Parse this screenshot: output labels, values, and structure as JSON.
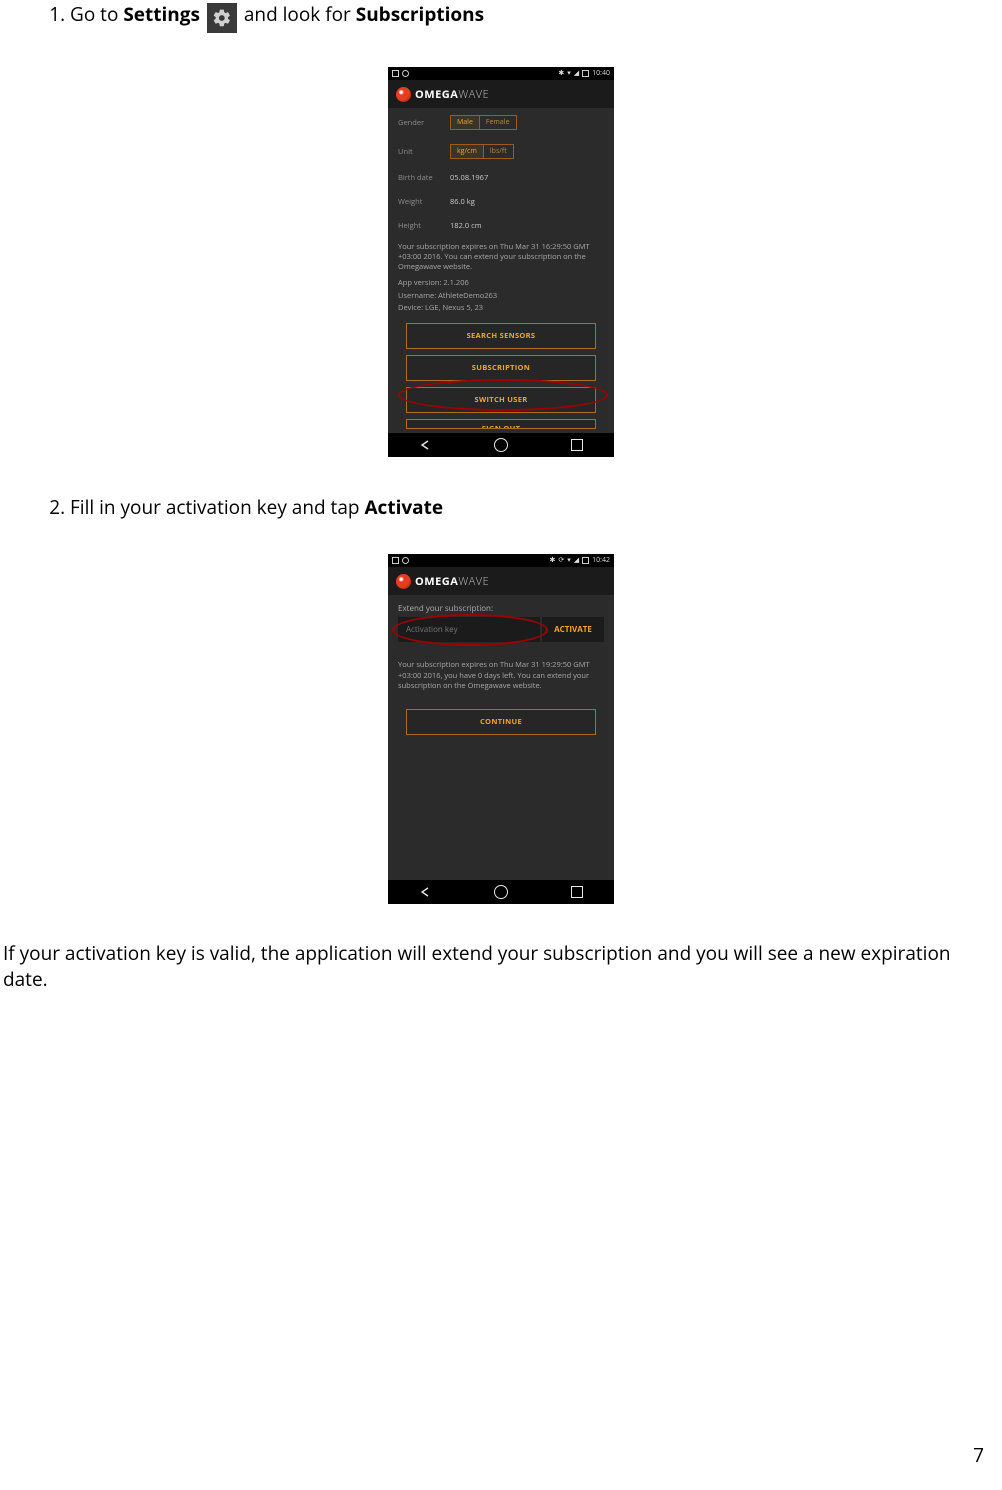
{
  "page_number": "7",
  "step1": {
    "num": "1.",
    "pre": "Go to ",
    "bold1": "Settings",
    "mid": " and look for ",
    "bold2": "Subscriptions"
  },
  "step2": {
    "num": "2.",
    "pre": "Fill in your activation key and tap ",
    "bold1": "Activate"
  },
  "closing": "If your activation key is valid, the application will extend your subscription and you will see a new expiration date.",
  "brand": {
    "part1": "OMEGA",
    "part2": "WAVE"
  },
  "shot1": {
    "time": "10:40",
    "rows": {
      "gender": {
        "label": "Gender",
        "opt1": "Male",
        "opt2": "Female"
      },
      "unit": {
        "label": "Unit",
        "opt1": "kg/cm",
        "opt2": "lbs/ft"
      },
      "birth": {
        "label": "Birth date",
        "value": "05.08.1967"
      },
      "weight": {
        "label": "Weight",
        "value": "86.0 kg"
      },
      "height": {
        "label": "Height",
        "value": "182.0 cm"
      }
    },
    "sub1": "Your subscription expires on Thu Mar 31 16:29:50 GMT +03:00 2016. You can extend your subscription on the Omegawave website.",
    "sub2": "App version: 2.1.206",
    "sub3": "Username: AthleteDemo263",
    "sub4": "Device: LGE, Nexus 5, 23",
    "buttons": {
      "search": "SEARCH SENSORS",
      "subscription": "SUBSCRIPTION",
      "switch": "SWITCH USER",
      "signout": "SIGN OUT"
    }
  },
  "shot2": {
    "time": "10:42",
    "extend": "Extend your subscription:",
    "placeholder": "Activation key",
    "activate": "ACTIVATE",
    "sub": "Your subscription expires on Thu Mar 31 19:29:50 GMT +03:00 2016, you have 0 days left. You can extend your subscription on the Omegawave website.",
    "continue": "CONTINUE"
  }
}
